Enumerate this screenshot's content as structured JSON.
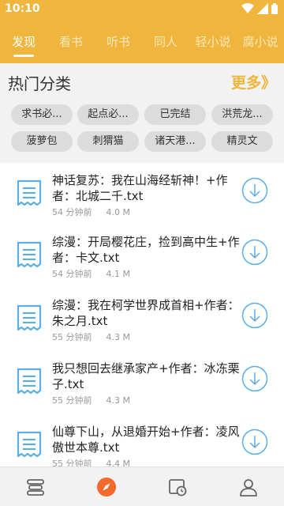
{
  "status_bar": {
    "time": "10:10"
  },
  "top_tabs": [
    {
      "label": "发现",
      "active": true
    },
    {
      "label": "看书",
      "active": false
    },
    {
      "label": "听书",
      "active": false
    },
    {
      "label": "同人",
      "active": false
    },
    {
      "label": "轻小说",
      "active": false
    },
    {
      "label": "腐小说",
      "active": false
    }
  ],
  "hot_categories": {
    "title": "热门分类",
    "more_label": "更多》",
    "chips": [
      "求书必...",
      "起点必...",
      "已完结",
      "洪荒龙...",
      "菠萝包",
      "刺猬猫",
      "诸天港...",
      "精灵文"
    ]
  },
  "files": [
    {
      "title": "神话复苏：我在山海经斩神！+作者：北城二千.txt",
      "time": "54 分钟前",
      "size": "4.0 M"
    },
    {
      "title": "综漫：开局樱花庄，捡到高中生+作者：卡文.txt",
      "time": "54 分钟前",
      "size": "4.1 M"
    },
    {
      "title": "综漫：我在柯学世界成首相+作者：朱之月.txt",
      "time": "55 分钟前",
      "size": "4.3 M"
    },
    {
      "title": "我只想回去继承家产+作者：冰冻栗子.txt",
      "time": "55 分钟前",
      "size": "4.3 M"
    },
    {
      "title": "仙尊下山，从退婚开始+作者：凌风傲世本尊.txt",
      "time": "55 分钟前",
      "size": "4.4 M"
    }
  ],
  "bottom_nav": [
    {
      "icon": "bookshelf-icon",
      "active": false
    },
    {
      "icon": "compass-icon",
      "active": true
    },
    {
      "icon": "history-icon",
      "active": false
    },
    {
      "icon": "user-icon",
      "active": false
    }
  ],
  "colors": {
    "accent": "#f0b53c",
    "icon_blue": "#5aaee6",
    "active_nav": "#f26a2e"
  }
}
